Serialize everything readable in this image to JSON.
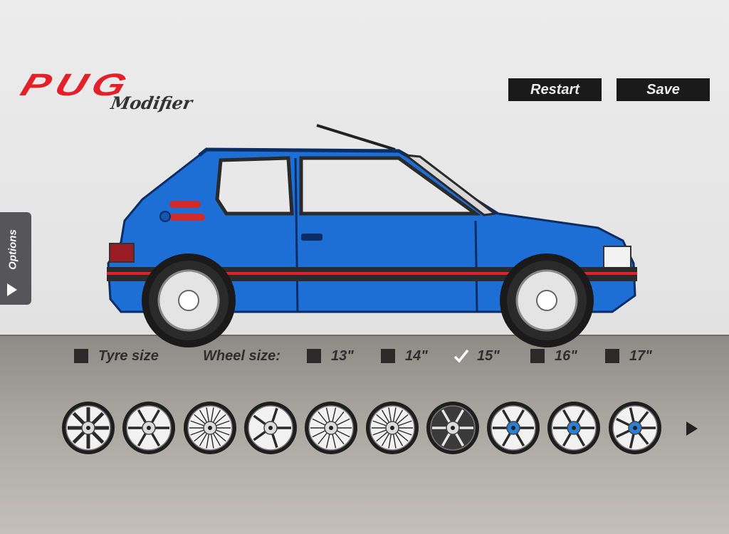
{
  "app": {
    "logo_main": "PUG",
    "logo_sub": "Modifier",
    "brand_red": "#e3202a",
    "car_color": "#1d6fd6"
  },
  "toolbar": {
    "restart_label": "Restart",
    "save_label": "Save"
  },
  "options_tab": {
    "label": "Options",
    "icon": "play-arrow-icon"
  },
  "controls": {
    "tyre_size_label": "Tyre size",
    "tyre_size_checked": false,
    "wheel_size_label": "Wheel size:",
    "wheel_sizes": [
      {
        "label": "13\"",
        "checked": false
      },
      {
        "label": "14\"",
        "checked": false
      },
      {
        "label": "15\"",
        "checked": true
      },
      {
        "label": "16\"",
        "checked": false
      },
      {
        "label": "17\"",
        "checked": false
      }
    ]
  },
  "wheel_styles": [
    {
      "name": "wheel-style-1-icon",
      "style": "slotted-8"
    },
    {
      "name": "wheel-style-2-icon",
      "style": "star-6"
    },
    {
      "name": "wheel-style-3-icon",
      "style": "turbine"
    },
    {
      "name": "wheel-style-4-icon",
      "style": "star-5"
    },
    {
      "name": "wheel-style-5-icon",
      "style": "multispoke"
    },
    {
      "name": "wheel-style-6-icon",
      "style": "mesh"
    },
    {
      "name": "wheel-style-7-icon",
      "style": "star-6-dark"
    },
    {
      "name": "wheel-style-8-icon",
      "style": "split-spoke-blue"
    },
    {
      "name": "wheel-style-9-icon",
      "style": "split-spoke-blue"
    },
    {
      "name": "wheel-style-10-icon",
      "style": "spoke-7-blue"
    }
  ],
  "next_arrow_icon": "chevron-right-icon"
}
